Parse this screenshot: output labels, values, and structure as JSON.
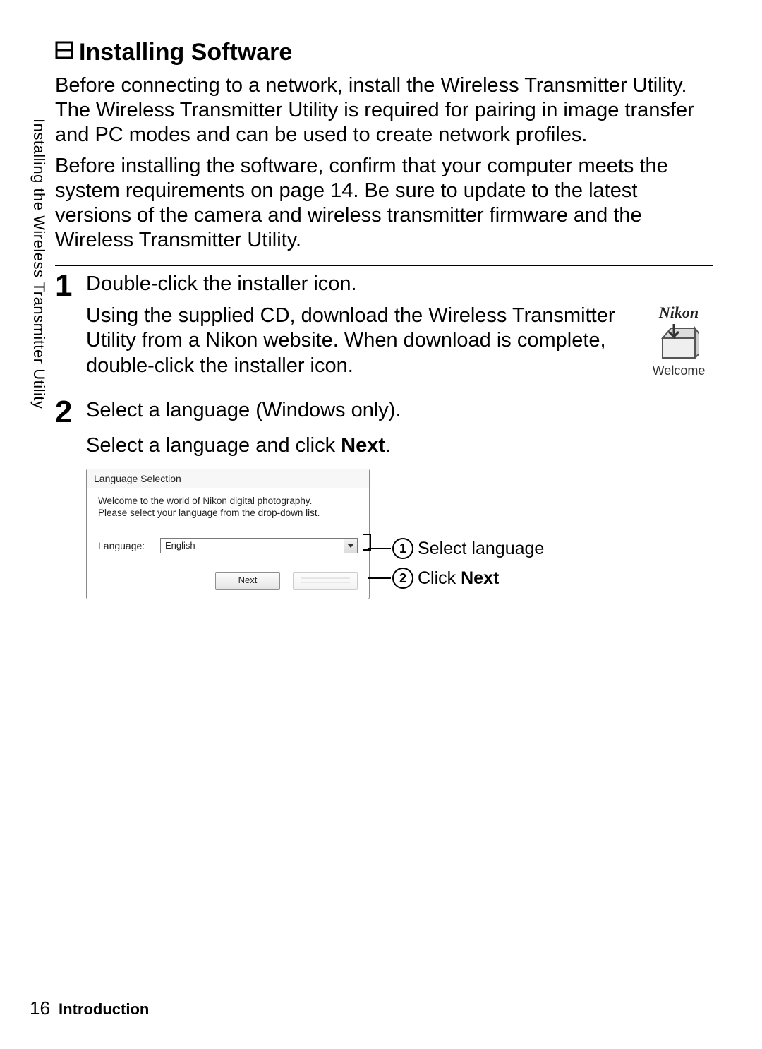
{
  "side_label": "Installing the Wireless Transmitter Utility",
  "heading": "Installing Software",
  "para1": "Before connecting to a network, install the Wireless Transmitter Utility. The Wireless Transmitter Utility is required for pairing in image transfer and PC modes and can be used to create network profiles.",
  "para2": "Before installing the software, confirm that your computer meets the system requirements on page 14. Be sure to update to the latest versions of the camera and wireless transmitter firmware and the Wireless Transmitter Utility.",
  "step1": {
    "num": "1",
    "title": "Double-click the installer icon.",
    "body": "Using the supplied CD, download the Wireless Transmitter Utility from a Nikon website. When download is complete, double-click the installer icon.",
    "icon_brand": "Nikon",
    "icon_caption": "Welcome"
  },
  "step2": {
    "num": "2",
    "title": "Select a language (Windows only).",
    "instruction_pre": "Select a language and click ",
    "instruction_bold": "Next",
    "instruction_post": "."
  },
  "dialog": {
    "title": "Language Selection",
    "msg_line1": "Welcome to the world of Nikon digital photography.",
    "msg_line2": "Please select your language from the drop-down list.",
    "label": "Language:",
    "selected": "English",
    "next_btn": "Next"
  },
  "callouts": {
    "c1_num": "1",
    "c1_text": "Select language",
    "c2_num": "2",
    "c2_pre": "Click ",
    "c2_bold": "Next"
  },
  "footer": {
    "page": "16",
    "section": "Introduction"
  }
}
